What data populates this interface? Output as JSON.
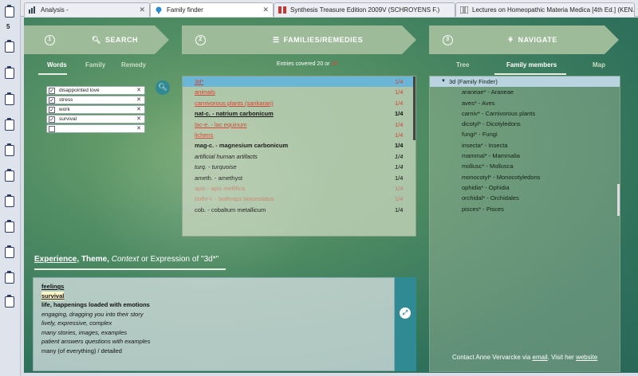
{
  "sidebar": {
    "clip_count": "5"
  },
  "tabs": [
    {
      "label": "Analysis -",
      "active": false
    },
    {
      "label": "Family finder",
      "active": true
    },
    {
      "label": "Synthesis Treasure Edition 2009V (SCHROYENS F.)",
      "active": false
    },
    {
      "label": "Lectures on Homeopathic Materia Medica [4th Ed.] (KEN...",
      "active": false
    }
  ],
  "steps": [
    {
      "num": "1",
      "title": "SEARCH",
      "icon": "search-icon"
    },
    {
      "num": "2",
      "title": "FAMILIES/REMEDIES",
      "icon": "list-icon"
    },
    {
      "num": "3",
      "title": "NAVIGATE",
      "icon": "sitemap-icon"
    }
  ],
  "search": {
    "tabs": [
      "Words",
      "Family",
      "Remedy"
    ],
    "active_tab": "Words",
    "words": [
      {
        "text": "disappointed love",
        "checked": true
      },
      {
        "text": "stress",
        "checked": true
      },
      {
        "text": "work",
        "checked": true
      },
      {
        "text": "survival",
        "checked": true
      },
      {
        "text": "",
        "checked": false
      }
    ]
  },
  "families": {
    "entries_label": "Entries covered 20 or",
    "entries_value": "20",
    "rows": [
      {
        "name": "3d*",
        "ratio": "1/4",
        "style": "red u hl"
      },
      {
        "name": "animals",
        "ratio": "1/4",
        "style": "red u"
      },
      {
        "name": "carnivorous plants (sankaran)",
        "ratio": "1/4",
        "style": "red u"
      },
      {
        "name": "nat-c. - natrium carbonicum",
        "ratio": "1/4",
        "style": "b u"
      },
      {
        "name": "lac-e. - lac equinum",
        "ratio": "1/4",
        "style": "red u"
      },
      {
        "name": "lichens",
        "ratio": "1/4",
        "style": "red u"
      },
      {
        "name": "mag-c. - magnesium carbonicum",
        "ratio": "1/4",
        "style": "b"
      },
      {
        "name": "artificial human artifacts",
        "ratio": "1/4",
        "style": "i"
      },
      {
        "name": "turq. - turquoise",
        "ratio": "1/4",
        "style": "i"
      },
      {
        "name": "ameth. - amethyst",
        "ratio": "1/4",
        "style": ""
      },
      {
        "name": "apis - apis mellifica",
        "ratio": "1/4",
        "style": "red faded"
      },
      {
        "name": "bothr-l. - bothrops lanceolatus",
        "ratio": "1/4",
        "style": "red faded"
      },
      {
        "name": "cob. - cobaltum metallicum",
        "ratio": "1/4",
        "style": ""
      },
      {
        "name": "",
        "ratio": "",
        "style": "red faded"
      }
    ]
  },
  "navigate": {
    "tabs": [
      "Tree",
      "Family members",
      "Map"
    ],
    "active_tab": "Family members",
    "root": "3d (Family Finder)",
    "items": [
      "araneae* - Araneae",
      "aves* - Aves",
      "carniv* - Carnivorous plants",
      "dicotyl* - Dicotyledons",
      "fungi* - Fungi",
      "insecta* - Insecta",
      "mammal* - Mammalia",
      "mollusc* - Mollusca",
      "monocotyl* - Monocotyledons",
      "ophidia* - Ophidia",
      "orchidal* - Orchidales",
      "pisces* - Pisces"
    ]
  },
  "experience": {
    "title_a": "Experience,",
    "title_b": "Theme,",
    "title_c": "Context",
    "title_d": "or Expression of \"3d*\"",
    "lines": [
      {
        "text": "feelings",
        "style": "b u"
      },
      {
        "text": "survival",
        "style": "b u hl"
      },
      {
        "text": "life, happenings loaded with emotions",
        "style": "b"
      },
      {
        "text": "engaging, dragging you into their story",
        "style": "i"
      },
      {
        "text": "lively, expressive, complex",
        "style": "i"
      },
      {
        "text": "many stories, images, examples",
        "style": "i"
      },
      {
        "text": "patient answers questions with examples",
        "style": "i"
      },
      {
        "text": "many (of everything) / detailed",
        "style": ""
      }
    ]
  },
  "contact": {
    "prefix": "Contact Anne Vervarcke via",
    "email": "email",
    "middle": ". Visit her",
    "website": "website"
  },
  "colors": {
    "accent": "#2f8a94",
    "red_link": "#d84030",
    "highlight": "#6bb6d6"
  }
}
